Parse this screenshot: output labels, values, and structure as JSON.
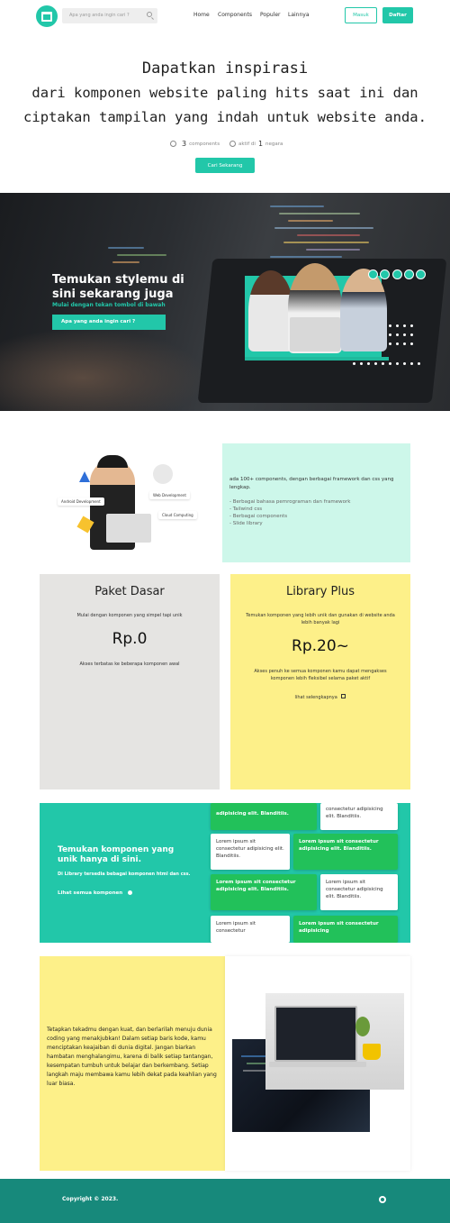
{
  "nav": {
    "search_placeholder": "Apa yang anda ingin cari ?",
    "links": [
      "Home",
      "Components",
      "Populer",
      "Lainnya"
    ],
    "masuk": "Masuk",
    "daftar": "Daftar"
  },
  "hero": {
    "line1": "Dapatkan inspirasi",
    "line2": "dari komponen website paling hits saat ini dan",
    "line3": "ciptakan tampilan yang indah untuk website anda.",
    "components_count": "3",
    "components_label": "components",
    "active_prefix": "aktif di",
    "active_count": "1",
    "active_label": "negara",
    "button": "Cari Sekarang"
  },
  "banner": {
    "title": "Temukan stylemu di sini sekarang juga",
    "subtitle": "Mulai dengan tekan tombol di bawah",
    "button": "Apa yang anda ingin cari ?"
  },
  "feature": {
    "tags": [
      "Android Development",
      "Web Development",
      "Cloud Computing"
    ],
    "intro": "ada 100+ components, dengan berbagai framework dan css yang lengkap.",
    "items": [
      "- Berbagai bahasa pemrograman dan framework",
      "- Tailwind css",
      "- Berbagai components",
      "- Slide library"
    ]
  },
  "pricing": [
    {
      "name": "Paket Dasar",
      "desc": "Mulai dengan komponen yang simpel tapi unik",
      "price": "Rp.0",
      "note": "Akses terbatas ke beberapa komponen awal",
      "color": "#e5e4e2"
    },
    {
      "name": "Library Plus",
      "desc": "Temukan komponen yang lebih unik dan gunakan di website anda lebih banyak lagi",
      "price": "Rp.20~",
      "note": "Akses penuh ke semua komponen kamu dapat mengakses komponen lebih fleksibel selama paket aktif",
      "link": "lihat selengkapnya",
      "color": "#fdf089"
    }
  ],
  "teal": {
    "heading": "Temukan komponen yang unik hanya di sini.",
    "sub": "Di Library tersedia bebagai komponen html dan css.",
    "link": "Lihat semua komponen",
    "tile_text_a": "Lorem ipsum sit consectetur adipisicing elit. Blanditiis.",
    "tile_text_b": "adipisicing elit. Blanditiis.",
    "tile_text_c": "consectetur adipisicing elit. Blanditiis.",
    "tile_text_d": "Lorem ipsum sit consectetur adipisicing",
    "tile_text_e": "Lorem ipsum sit consectetur"
  },
  "story": {
    "text": "Tetapkan tekadmu dengan kuat, dan berlarilah menuju dunia coding yang menakjubkan! Dalam setiap baris kode, kamu menciptakan keajaiban di dunia digital. Jangan biarkan hambatan menghalangimu, karena di balik setiap tantangan, kesempatan tumbuh untuk belajar dan berkembang. Setiap langkah maju membawa kamu lebih dekat pada keahlian yang luar biasa."
  },
  "footer": {
    "copyright": "Copyright © 2023."
  },
  "colors": {
    "accent": "#22c7a9",
    "green": "#22c15a",
    "mint": "#cdf7ea",
    "yellow": "#fdf089",
    "footer": "#17897b"
  }
}
